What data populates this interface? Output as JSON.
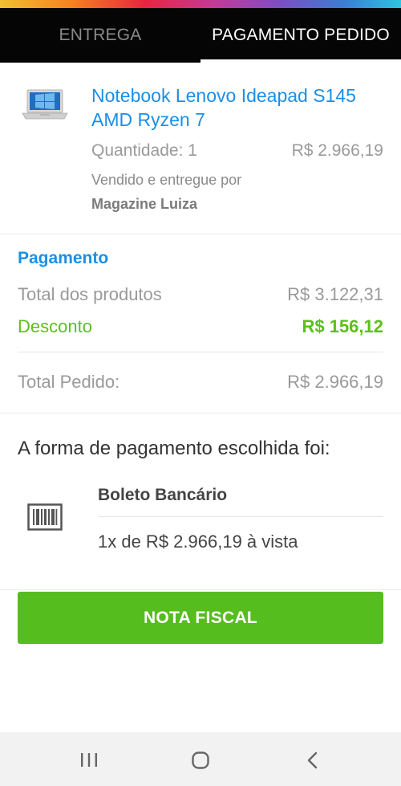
{
  "colors": {
    "link_blue": "#1a8fe8",
    "discount_green": "#5cbf1a",
    "button_green": "#56bd1f",
    "tabbar_black": "#050505"
  },
  "tabs": [
    {
      "label": "ENTREGA",
      "active": false
    },
    {
      "label": "PAGAMENTO PEDIDO",
      "active": true
    }
  ],
  "product": {
    "image_icon": "laptop-thumbnail",
    "title": "Notebook Lenovo Ideapad S145 AMD Ryzen 7",
    "quantity": "Quantidade: 1",
    "price": "R$ 2.966,19",
    "sold_by_label": "Vendido e entregue por",
    "seller": "Magazine Luiza"
  },
  "payment": {
    "heading": "Pagamento",
    "total_products_label": "Total dos produtos",
    "total_products_value": "R$ 3.122,31",
    "discount_label": "Desconto",
    "discount_value": "R$ 156,12",
    "total_order_label": "Total Pedido:",
    "total_order_value": "R$ 2.966,19"
  },
  "method": {
    "heading": "A forma de pagamento escolhida foi:",
    "icon": "barcode-icon",
    "name": "Boleto Bancário",
    "installment": "1x de R$ 2.966,19 à vista"
  },
  "nota_fiscal_button": "NOTA FISCAL",
  "navbar": {
    "icons": [
      "recent-apps-icon",
      "home-icon",
      "back-icon"
    ]
  }
}
